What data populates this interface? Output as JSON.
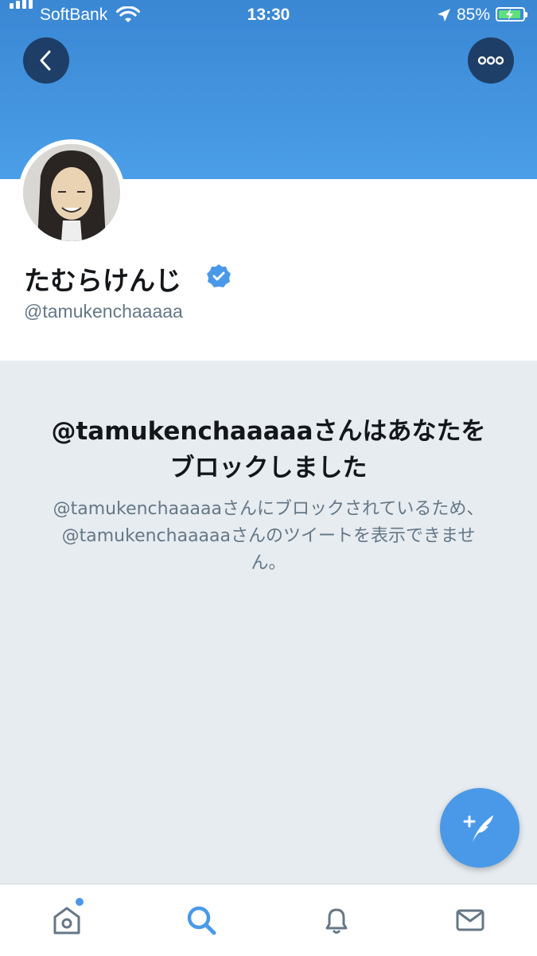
{
  "status_bar": {
    "carrier": "SoftBank",
    "time": "13:30",
    "battery_percent": "85%"
  },
  "profile": {
    "display_name": "たむらけんじ",
    "handle": "@tamukenchaaaaa",
    "verified": true
  },
  "blocked": {
    "title": "@tamukenchaaaaaさんはあなたをブロックしました",
    "description": "@tamukenchaaaaaさんにブロックされているため、@tamukenchaaaaaさんのツイートを表示できません。"
  },
  "colors": {
    "banner": "#4b9ee8",
    "accent": "#4a99e9",
    "background": "#e6ecf0"
  },
  "tabs": [
    {
      "icon": "home-icon",
      "has_badge": true
    },
    {
      "icon": "search-icon",
      "active": true
    },
    {
      "icon": "bell-icon"
    },
    {
      "icon": "mail-icon"
    }
  ]
}
